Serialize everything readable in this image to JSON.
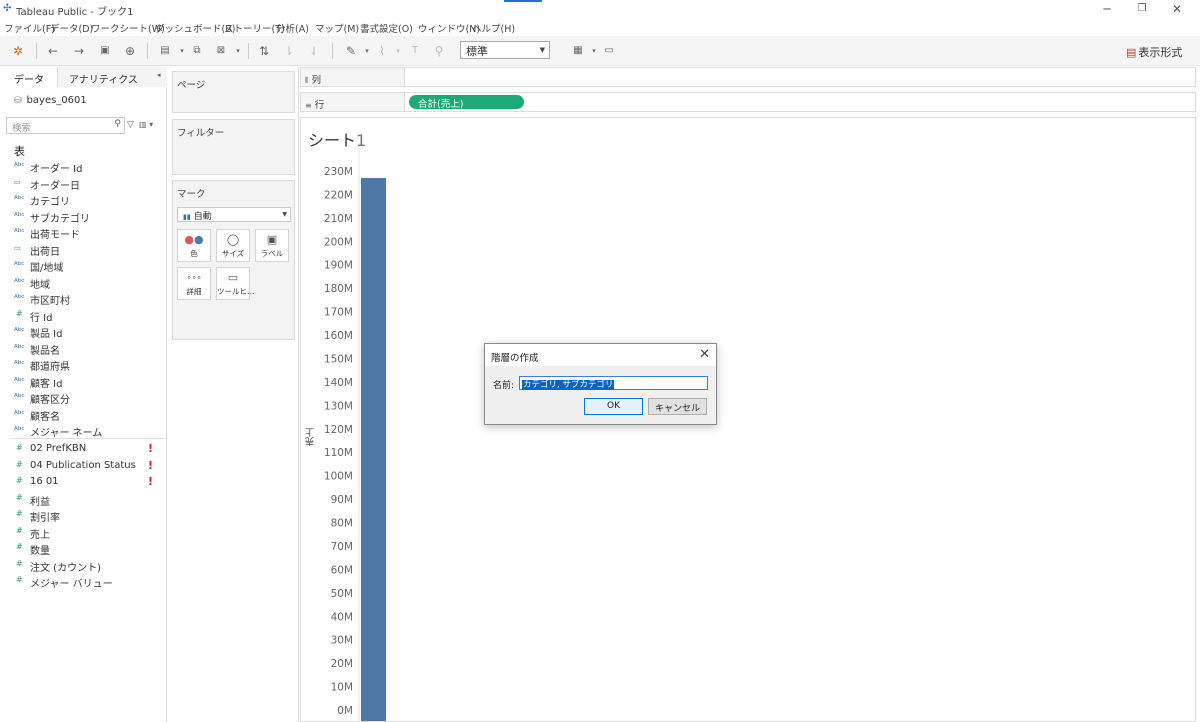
{
  "window": {
    "title": "Tableau Public - ブック1",
    "minimize_icon": "minimize-icon",
    "restore_icon": "restore-icon",
    "close_icon": "close-icon"
  },
  "menu": [
    "ファイル(F)",
    "データ(D)",
    "ワークシート(W)",
    "ダッシュボード(B)",
    "ストーリー(T)",
    "分析(A)",
    "マップ(M)",
    "書式設定(O)",
    "ウィンドウ(N)",
    "ヘルプ(H)"
  ],
  "toolbar": {
    "zoom_value": "標準",
    "show_me_label": "表示形式"
  },
  "data_pane": {
    "tab_data": "データ",
    "tab_analytics": "アナリティクス",
    "datasource": "bayes_0601",
    "search_placeholder": "検索",
    "tables_heading": "表",
    "dimensions": [
      {
        "label": "オーダー Id",
        "icon": "abc-icon"
      },
      {
        "label": "オーダー日",
        "icon": "calendar-icon"
      },
      {
        "label": "カテゴリ",
        "icon": "abc-icon"
      },
      {
        "label": "サブカテゴリ",
        "icon": "abc-icon"
      },
      {
        "label": "出荷モード",
        "icon": "abc-icon"
      },
      {
        "label": "出荷日",
        "icon": "calendar-icon"
      },
      {
        "label": "国/地域",
        "icon": "abc-icon"
      },
      {
        "label": "地域",
        "icon": "abc-icon"
      },
      {
        "label": "市区町村",
        "icon": "abc-icon"
      },
      {
        "label": "行 Id",
        "icon": "number-icon"
      },
      {
        "label": "製品 Id",
        "icon": "abc-icon"
      },
      {
        "label": "製品名",
        "icon": "abc-icon"
      },
      {
        "label": "都道府県",
        "icon": "abc-icon"
      },
      {
        "label": "顧客 Id",
        "icon": "abc-icon"
      },
      {
        "label": "顧客区分",
        "icon": "abc-icon"
      },
      {
        "label": "顧客名",
        "icon": "abc-icon"
      },
      {
        "label": "メジャー ネーム",
        "icon": "abc-icon"
      }
    ],
    "measures": [
      {
        "label": "02 PrefKBN",
        "warning": "!"
      },
      {
        "label": "04 Publication Status",
        "warning": "!"
      },
      {
        "label": "16 01",
        "warning": "!"
      },
      {
        "label": "利益",
        "warning": ""
      },
      {
        "label": "割引率",
        "warning": ""
      },
      {
        "label": "売上",
        "warning": ""
      },
      {
        "label": "数量",
        "warning": ""
      },
      {
        "label": "注文 (カウント)",
        "warning": ""
      },
      {
        "label": "メジャー バリュー",
        "warning": ""
      }
    ]
  },
  "cards": {
    "pages": "ページ",
    "filters": "フィルター",
    "marks": "マーク",
    "mark_type": "自動",
    "mark_buttons": [
      {
        "label": "色",
        "icon": "color-icon"
      },
      {
        "label": "サイズ",
        "icon": "size-icon"
      },
      {
        "label": "ラベル",
        "icon": "label-icon"
      },
      {
        "label": "詳細",
        "icon": "detail-icon"
      },
      {
        "label": "ツールヒ…",
        "icon": "tooltip-icon"
      }
    ]
  },
  "shelves": {
    "columns_label": "列",
    "rows_label": "行",
    "rows_pill": "合計(売上)"
  },
  "sheet": {
    "title_text": "シート",
    "title_num": "1",
    "ylabel": "売上"
  },
  "chart_data": {
    "type": "bar",
    "categories": [
      ""
    ],
    "series": [
      {
        "name": "合計(売上)",
        "values": [
          227
        ]
      }
    ],
    "value_unit": "M",
    "ylabel": "売上",
    "ylim": [
      0,
      230
    ],
    "yticks": [
      "0M",
      "10M",
      "20M",
      "30M",
      "40M",
      "50M",
      "60M",
      "70M",
      "80M",
      "90M",
      "100M",
      "110M",
      "120M",
      "130M",
      "140M",
      "150M",
      "160M",
      "170M",
      "180M",
      "190M",
      "200M",
      "210M",
      "220M",
      "230M"
    ],
    "color": "#4e79a7",
    "grid": false
  },
  "dialog": {
    "title": "階層の作成",
    "name_label": "名前:",
    "name_value": "カテゴリ, サブカテゴリ",
    "ok_label": "OK",
    "cancel_label": "キャンセル"
  }
}
